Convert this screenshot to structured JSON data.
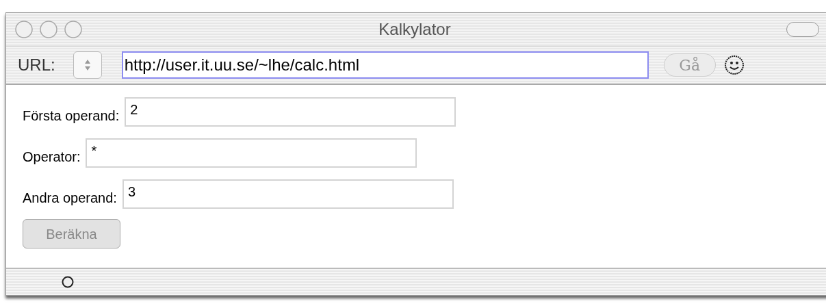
{
  "window": {
    "title": "Kalkylator"
  },
  "toolbar": {
    "url_label": "URL:",
    "url": "http://user.it.uu.se/~lhe/calc.html",
    "go_button": {
      "label": "Gå",
      "disabled": true
    }
  },
  "form": {
    "fields": [
      {
        "label": "Första operand:",
        "value": "2"
      },
      {
        "label": "Operator:",
        "value": "*"
      },
      {
        "label": "Andra operand:",
        "value": "3"
      }
    ],
    "submit": {
      "label": "Beräkna",
      "disabled": true
    }
  }
}
